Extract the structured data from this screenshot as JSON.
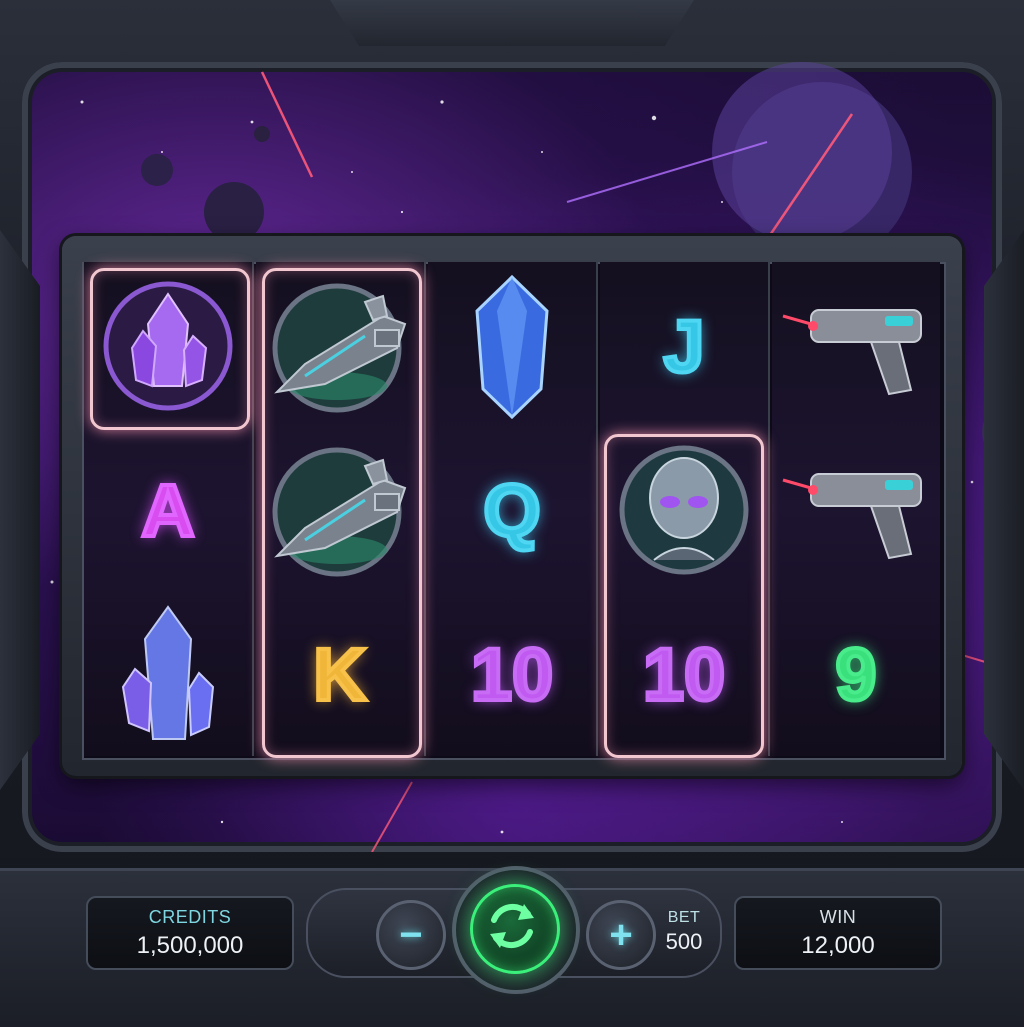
{
  "reels": [
    [
      {
        "symbol": "purple-crystal-badge-icon",
        "type": "icon"
      },
      {
        "symbol": "A",
        "type": "letter",
        "color": "pink"
      },
      {
        "symbol": "blue-crystal-cluster-icon",
        "type": "icon"
      }
    ],
    [
      {
        "symbol": "spaceship-badge-icon",
        "type": "icon"
      },
      {
        "symbol": "spaceship-badge-icon",
        "type": "icon"
      },
      {
        "symbol": "K",
        "type": "letter",
        "color": "gold"
      }
    ],
    [
      {
        "symbol": "blue-gem-icon",
        "type": "icon"
      },
      {
        "symbol": "Q",
        "type": "letter",
        "color": "cyan"
      },
      {
        "symbol": "10",
        "type": "letter",
        "color": "magenta"
      }
    ],
    [
      {
        "symbol": "J",
        "type": "letter",
        "color": "cyan"
      },
      {
        "symbol": "alien-badge-icon",
        "type": "icon"
      },
      {
        "symbol": "10",
        "type": "letter",
        "color": "magenta"
      }
    ],
    [
      {
        "symbol": "laser-blaster-icon",
        "type": "icon"
      },
      {
        "symbol": "laser-blaster-icon",
        "type": "icon"
      },
      {
        "symbol": "9",
        "type": "letter",
        "color": "green"
      }
    ]
  ],
  "highlighted_cells": [
    "reel-1-row-1",
    "reel-2-rows-1-3",
    "reel-4-rows-2-3"
  ],
  "controls": {
    "credits_label": "CREDITS",
    "credits_value": "1,500,000",
    "minus_label": "−",
    "plus_label": "+",
    "bet_label": "BET",
    "bet_value": "500",
    "win_label": "WIN",
    "win_value": "12,000",
    "spin_icon": "spin-arrows-icon"
  },
  "colors": {
    "accent_green": "#3af07a",
    "accent_cyan": "#7fd6e0",
    "highlight": "#f2c7cf",
    "space_purple": "#2a1150"
  }
}
